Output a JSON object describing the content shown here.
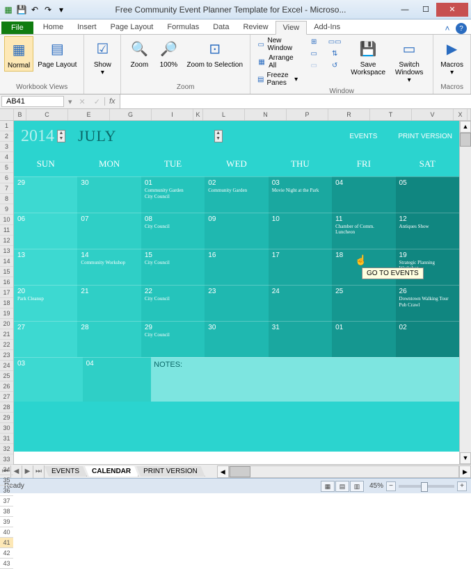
{
  "titlebar": {
    "title": "Free Community Event Planner Template for Excel - Microso..."
  },
  "ribbon_tabs": [
    "Home",
    "Insert",
    "Page Layout",
    "Formulas",
    "Data",
    "Review",
    "View",
    "Add-Ins"
  ],
  "active_tab": "View",
  "ribbon": {
    "workbook_views": {
      "label": "Workbook Views",
      "normal": "Normal",
      "page_layout": "Page Layout"
    },
    "show": {
      "label": "",
      "show": "Show"
    },
    "zoom": {
      "label": "Zoom",
      "zoom": "Zoom",
      "hundred": "100%",
      "to_selection": "Zoom to Selection"
    },
    "window": {
      "label": "Window",
      "new_window": "New Window",
      "arrange_all": "Arrange All",
      "freeze_panes": "Freeze Panes",
      "save_workspace": "Save Workspace",
      "switch_windows": "Switch Windows"
    },
    "macros": {
      "label": "Macros",
      "macros": "Macros"
    }
  },
  "file_label": "File",
  "namebox": "AB41",
  "columns": [
    "B",
    "C",
    "E",
    "G",
    "I",
    "K",
    "L",
    "N",
    "P",
    "R",
    "T",
    "V",
    "X"
  ],
  "rows_visible": [
    "1",
    "2",
    "3",
    "4",
    "5",
    "6",
    "7",
    "8",
    "9",
    "10",
    "11",
    "12",
    "13",
    "14",
    "15",
    "16",
    "17",
    "18",
    "19",
    "20",
    "21",
    "22",
    "23",
    "24",
    "25",
    "26",
    "27",
    "28",
    "29",
    "30",
    "31",
    "32",
    "33",
    "34",
    "35",
    "36",
    "37",
    "38",
    "39",
    "40",
    "41",
    "42",
    "43"
  ],
  "calendar": {
    "year": "2014",
    "month": "JULY",
    "links": {
      "events": "EVENTS",
      "print_version": "PRINT VERSION"
    },
    "tooltip": "GO TO EVENTS",
    "dow": [
      "SUN",
      "MON",
      "TUE",
      "WED",
      "THU",
      "FRI",
      "SAT"
    ],
    "weeks": [
      [
        {
          "n": "29",
          "e": []
        },
        {
          "n": "30",
          "e": []
        },
        {
          "n": "01",
          "e": [
            "Community Garden",
            "City Council"
          ]
        },
        {
          "n": "02",
          "e": [
            "Community Garden"
          ]
        },
        {
          "n": "03",
          "e": [
            "Movie Night at the Park"
          ]
        },
        {
          "n": "04",
          "e": []
        },
        {
          "n": "05",
          "e": []
        }
      ],
      [
        {
          "n": "06",
          "e": []
        },
        {
          "n": "07",
          "e": []
        },
        {
          "n": "08",
          "e": [
            "City Council"
          ]
        },
        {
          "n": "09",
          "e": []
        },
        {
          "n": "10",
          "e": []
        },
        {
          "n": "11",
          "e": [
            "Chamber of Comm. Luncheon"
          ]
        },
        {
          "n": "12",
          "e": [
            "Antiques Show"
          ]
        }
      ],
      [
        {
          "n": "13",
          "e": []
        },
        {
          "n": "14",
          "e": [
            "Community Workshop"
          ]
        },
        {
          "n": "15",
          "e": [
            "City Council"
          ]
        },
        {
          "n": "16",
          "e": []
        },
        {
          "n": "17",
          "e": []
        },
        {
          "n": "18",
          "e": []
        },
        {
          "n": "19",
          "e": [
            "Strategic Planning Workshop"
          ]
        }
      ],
      [
        {
          "n": "20",
          "e": [
            "Park Cleanup"
          ]
        },
        {
          "n": "21",
          "e": []
        },
        {
          "n": "22",
          "e": [
            "City Council"
          ]
        },
        {
          "n": "23",
          "e": []
        },
        {
          "n": "24",
          "e": []
        },
        {
          "n": "25",
          "e": []
        },
        {
          "n": "26",
          "e": [
            "Downtown Walking Tour",
            "Pub Crawl"
          ]
        }
      ],
      [
        {
          "n": "27",
          "e": []
        },
        {
          "n": "28",
          "e": []
        },
        {
          "n": "29",
          "e": [
            "City Council"
          ]
        },
        {
          "n": "30",
          "e": []
        },
        {
          "n": "31",
          "e": []
        },
        {
          "n": "01",
          "e": []
        },
        {
          "n": "02",
          "e": []
        }
      ],
      [
        {
          "n": "03",
          "e": []
        },
        {
          "n": "04",
          "e": []
        }
      ]
    ],
    "notes_label": "NOTES:"
  },
  "sheet_tabs": [
    "EVENTS",
    "CALENDAR",
    "PRINT VERSION"
  ],
  "active_sheet": "CALENDAR",
  "status": {
    "ready": "Ready",
    "zoom": "45%"
  }
}
